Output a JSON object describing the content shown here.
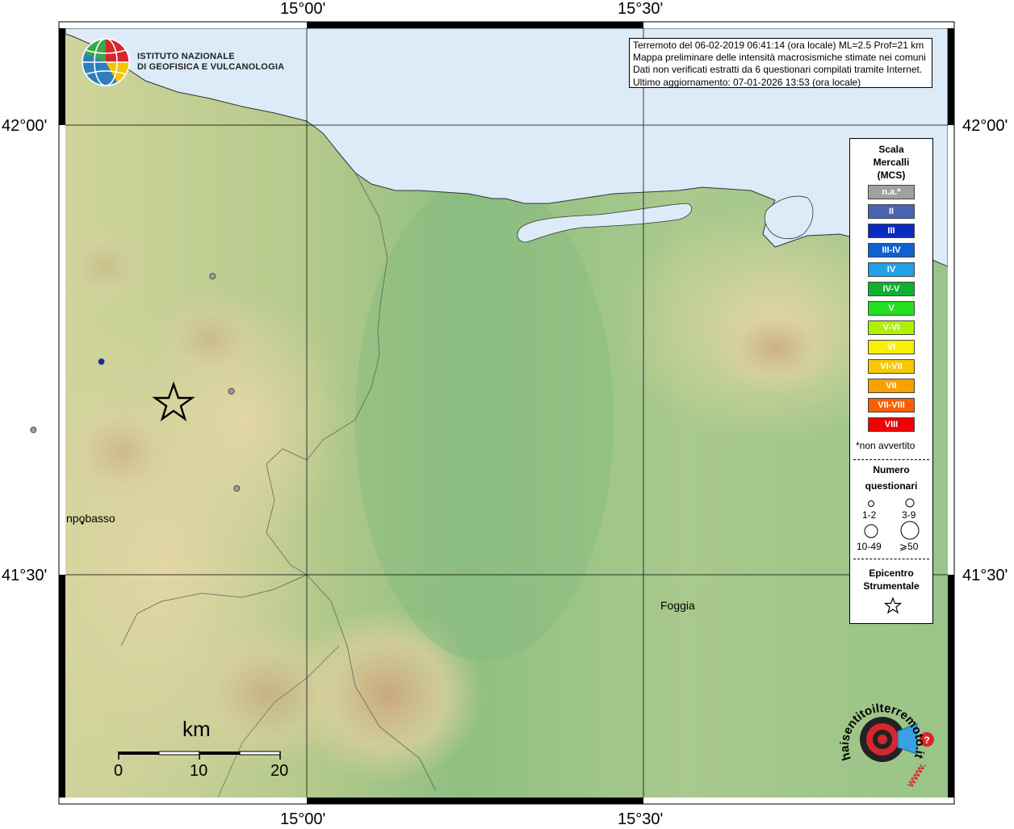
{
  "map": {
    "lon_labels": [
      "15°00'",
      "15°30'"
    ],
    "lat_labels": [
      "42°00'",
      "41°30'"
    ],
    "cities": [
      {
        "name": "npobasso"
      },
      {
        "name": "Foggia"
      }
    ],
    "info_lines": [
      "Terremoto del 06-02-2019 06:41:14 (ora locale) ML=2.5 Prof=21 km",
      "Mappa preliminare delle intensità macrosismiche stimate nei comuni",
      "Dati non verificati estratti da 6 questionari compilati tramite Internet.",
      "Ultimo aggiornamento: 07-01-2026 13:53 (ora locale)"
    ],
    "institute": [
      "ISTITUTO NAZIONALE",
      "DI GEOFISICA E VULCANOLOGIA"
    ],
    "scale_bar": {
      "unit": "km",
      "ticks": [
        "0",
        "10",
        "20"
      ]
    },
    "icons": [
      "ingv-globe-logo",
      "epicenter-star-icon",
      "hai-sentito-il-terremoto-logo"
    ],
    "colors": {
      "sea": "#dcebf7",
      "lowland": "#8fbf82",
      "hills": "#d8cf9c",
      "mountains": "#c9a77c"
    }
  },
  "legend": {
    "title": [
      "Scala",
      "Mercalli",
      "(MCS)"
    ],
    "classes": [
      {
        "label": "n.a.*",
        "color": "#a0a0a0"
      },
      {
        "label": "II",
        "color": "#4a64b4"
      },
      {
        "label": "III",
        "color": "#0a2ac0"
      },
      {
        "label": "III-IV",
        "color": "#1060d0"
      },
      {
        "label": "IV",
        "color": "#20a0e8"
      },
      {
        "label": "IV-V",
        "color": "#10b030"
      },
      {
        "label": "V",
        "color": "#20e020"
      },
      {
        "label": "V-VI",
        "color": "#b0f000"
      },
      {
        "label": "VI",
        "color": "#f8f000"
      },
      {
        "label": "VI-VII",
        "color": "#f8c800"
      },
      {
        "label": "VII",
        "color": "#f8a000"
      },
      {
        "label": "VII-VIII",
        "color": "#f86000"
      },
      {
        "label": "VIII",
        "color": "#f00000"
      }
    ],
    "not_felt_note": "*non avvertito",
    "count_title": [
      "Numero",
      "questionari"
    ],
    "count_classes": [
      "1-2",
      "3-9",
      "10-49",
      "⩾50"
    ],
    "epicenter_title": [
      "Epicentro",
      "Strumentale"
    ]
  },
  "observations": [
    {
      "lon": 14.86,
      "lat": 41.832,
      "intensity": "n.a.*"
    },
    {
      "lon": 14.888,
      "lat": 41.704,
      "intensity": "n.a.*"
    },
    {
      "lon": 14.594,
      "lat": 41.661,
      "intensity": "n.a.*"
    },
    {
      "lon": 14.896,
      "lat": 41.596,
      "intensity": "n.a.*"
    },
    {
      "lon": 14.695,
      "lat": 41.737,
      "intensity": "III"
    }
  ],
  "epicenter": {
    "lon": 14.711,
    "lat": 41.716
  },
  "logo_text": {
    "site": "haisentitoilterremoto.it",
    "www": "www."
  }
}
